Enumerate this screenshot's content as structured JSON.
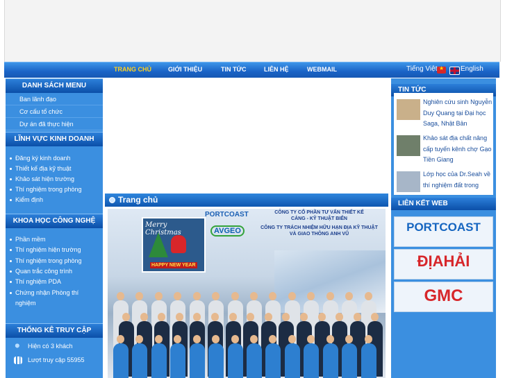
{
  "nav": {
    "items": [
      {
        "label": "TRANG CHỦ",
        "active": true
      },
      {
        "label": "GIỚI THIỆU"
      },
      {
        "label": "TIN TỨC"
      },
      {
        "label": "LIÊN HỆ"
      },
      {
        "label": "WEBMAIL"
      }
    ],
    "lang_vi": "Tiếng Việt",
    "lang_en": "English"
  },
  "left": {
    "menu_title": "DANH SÁCH MENU",
    "menu_items": [
      "Ban lãnh đạo",
      "Cơ cấu tổ chức",
      "Dự án đã thực hiện"
    ],
    "business_title": "LĨNH VỰC KINH DOANH",
    "business_items": [
      "Đăng ký kinh doanh",
      "Thiết kế địa kỹ thuật",
      "Khảo sát hiện trường",
      "Thí nghiệm trong phòng",
      "Kiểm định"
    ],
    "science_title": "KHOA HỌC CÔNG NGHỆ",
    "science_items": [
      "Phần mềm",
      "Thí nghiệm hiện trường",
      "Thí nghiệm trong phòng",
      "Quan trắc công trình",
      "Thí nghiệm PDA",
      "Chứng nhận Phòng thí nghiệm"
    ],
    "stats_title": "THỐNG KÊ TRUY CẬP",
    "online": "Hiện có 3 khách",
    "visits": "Lượt truy cập 55955"
  },
  "center": {
    "title": "Trang chủ",
    "photo": {
      "portcoast": "PORTCOAST",
      "avgeo": "AVGEO",
      "company1_l1": "CÔNG TY CỔ PHẦN TƯ VẤN THIẾT KẾ",
      "company1_l2": "CẢNG - KỸ THUẬT BIỂN",
      "company2_l1": "CÔNG TY TRÁCH NHIỆM HỮU HẠN ĐỊA KỸ THUẬT",
      "company2_l2": "VÀ GIAO THÔNG ANH VŨ",
      "merry": "Merry Christmas",
      "new_year": "HAPPY NEW YEAR"
    }
  },
  "right": {
    "news_title": "TIN TỨC",
    "news": [
      "Nghiên cứu sinh Nguyễn Duy Quang tại Đại học Saga, Nhật Bản",
      "Khảo sát địa chất nâng cấp tuyến kênh chợ Gạo - Tiền Giang",
      "Lớp học của Dr.Seah về thí nghiệm đất trong"
    ],
    "links_title": "LIÊN KẾT WEB",
    "links": [
      "PORTCOAST",
      "ĐỊAHẢI",
      "GMC"
    ]
  },
  "colors": {
    "nav_active": "#ffd21f",
    "panel_blue": "#3b8fe0",
    "header_blue": "#0b4fa8"
  }
}
